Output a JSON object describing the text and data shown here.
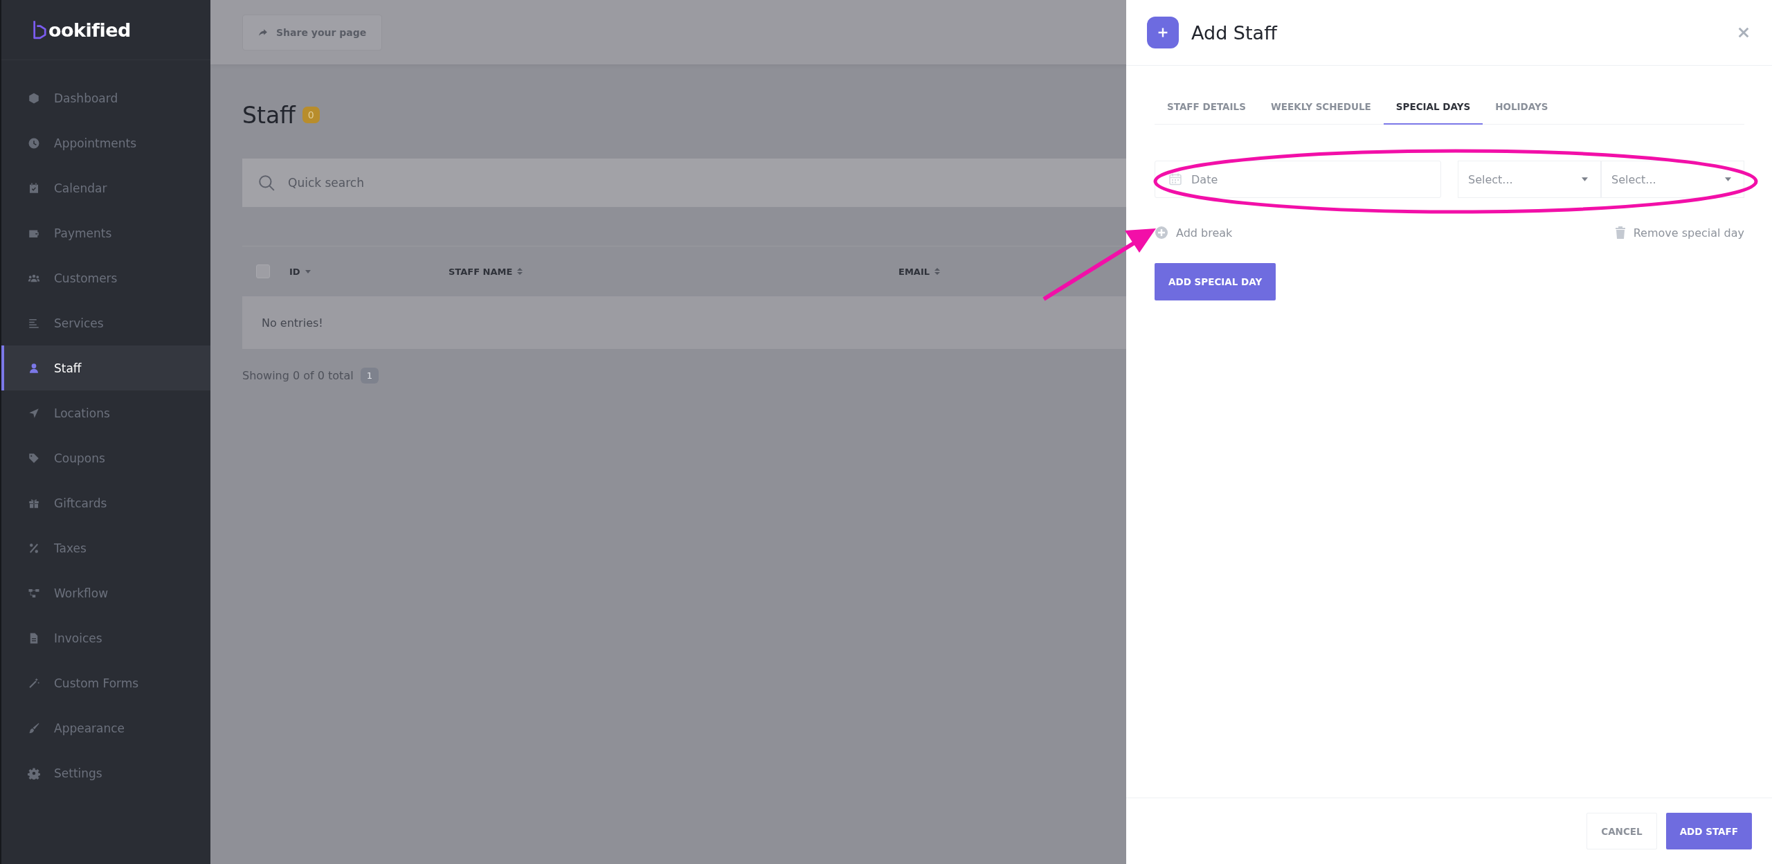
{
  "sidebar": {
    "logo": "ookified",
    "items": [
      {
        "label": "Dashboard",
        "selected": false
      },
      {
        "label": "Appointments",
        "selected": false
      },
      {
        "label": "Calendar",
        "selected": false
      },
      {
        "label": "Payments",
        "selected": false
      },
      {
        "label": "Customers",
        "selected": false
      },
      {
        "label": "Services",
        "selected": false
      },
      {
        "label": "Staff",
        "selected": true
      },
      {
        "label": "Locations",
        "selected": false
      },
      {
        "label": "Coupons",
        "selected": false
      },
      {
        "label": "Giftcards",
        "selected": false
      },
      {
        "label": "Taxes",
        "selected": false
      },
      {
        "label": "Workflow",
        "selected": false
      },
      {
        "label": "Invoices",
        "selected": false
      },
      {
        "label": "Custom Forms",
        "selected": false
      },
      {
        "label": "Appearance",
        "selected": false
      },
      {
        "label": "Settings",
        "selected": false
      }
    ]
  },
  "topbar": {
    "share_button": "Share your page"
  },
  "page": {
    "title": "Staff",
    "count": "0",
    "search": {
      "placeholder": "Quick search"
    },
    "table": {
      "columns": [
        {
          "label": "ID",
          "sorted": true
        },
        {
          "label": "STAFF NAME",
          "sorted": false
        },
        {
          "label": "EMAIL",
          "sorted": false
        }
      ],
      "select_all": {
        "checked": false
      },
      "empty_message": "No entries!"
    },
    "pagination": {
      "summary": "Showing 0 of 0 total",
      "pages": [
        {
          "label": "1",
          "selected": true
        }
      ]
    }
  },
  "modal": {
    "title": "Add Staff",
    "tabs": [
      {
        "label": "STAFF DETAILS",
        "selected": false
      },
      {
        "label": "WEEKLY SCHEDULE",
        "selected": false
      },
      {
        "label": "SPECIAL DAYS",
        "selected": true
      },
      {
        "label": "HOLIDAYS",
        "selected": false
      }
    ],
    "special_day": {
      "date": {
        "placeholder": "Date"
      },
      "selects": [
        {
          "placeholder": "Select..."
        },
        {
          "placeholder": "Select..."
        }
      ],
      "add_break": "Add break",
      "remove": "Remove special day"
    },
    "add_special_day": "ADD SPECIAL DAY",
    "buttons": [
      {
        "label": "CANCEL",
        "kind": "secondary"
      },
      {
        "label": "ADD STAFF",
        "kind": "primary"
      }
    ]
  }
}
